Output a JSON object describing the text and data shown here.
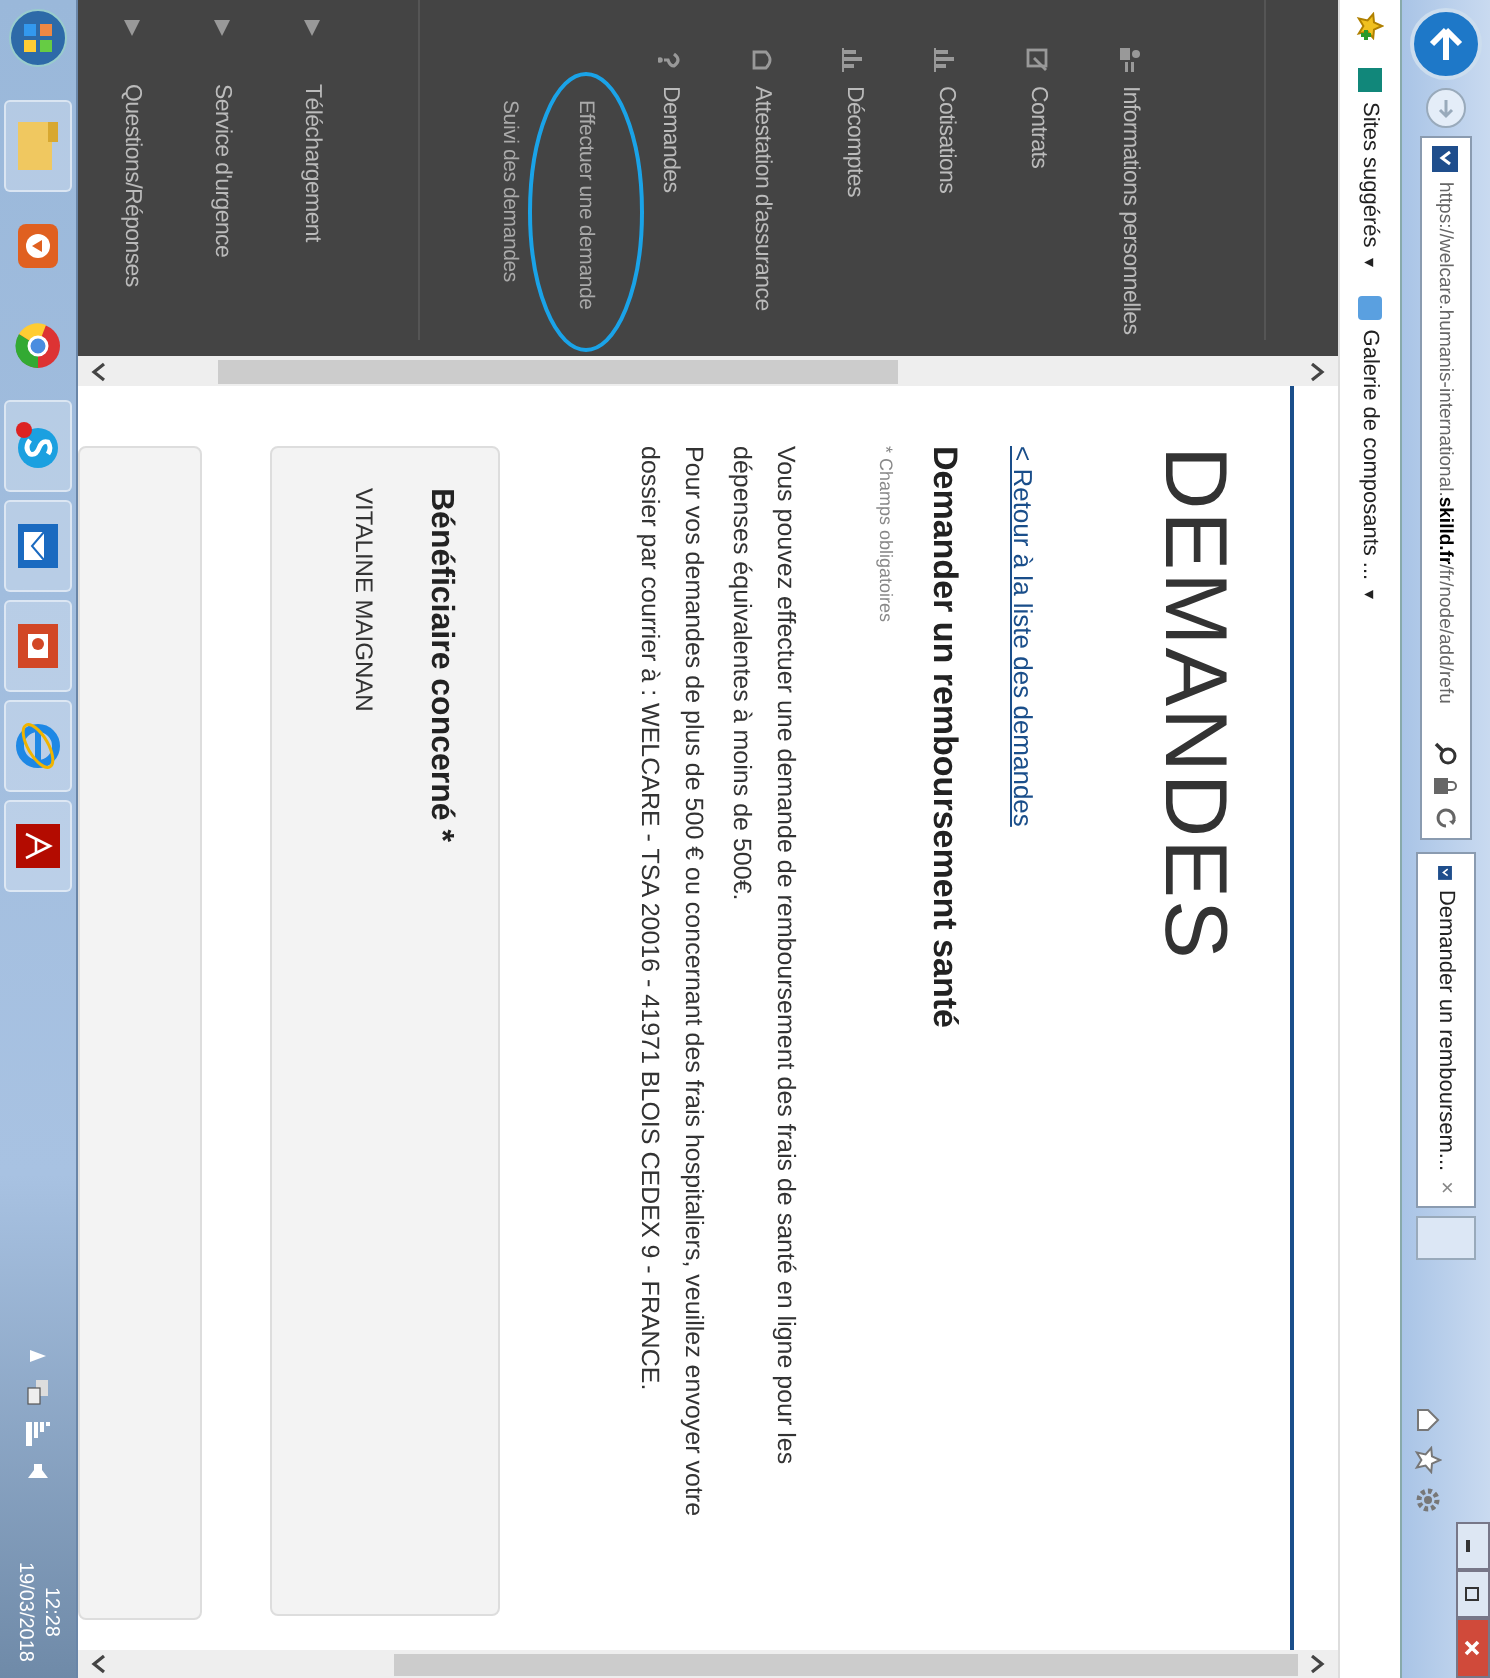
{
  "browser": {
    "address": "https://welcare.humanis-international.**skilld.fr**/fr/node/add/refu",
    "tab": {
      "title": "Demander un remboursem...",
      "close": "×"
    }
  },
  "favorites": [
    {
      "label": "Sites suggérés",
      "caret": "▾"
    },
    {
      "label": "Galerie de composants ...",
      "caret": "▾"
    }
  ],
  "sidebar": {
    "items": [
      {
        "kind": "link",
        "label": "Informations personnelles"
      },
      {
        "kind": "link",
        "label": "Contrats"
      },
      {
        "kind": "link",
        "label": "Cotisations"
      },
      {
        "kind": "link",
        "label": "Décomptes"
      },
      {
        "kind": "link",
        "label": "Attestation d'assurance"
      },
      {
        "kind": "link",
        "label": "Demandes",
        "children": [
          {
            "label": "Effectuer une demande"
          },
          {
            "label": "Suivi des demandes"
          }
        ]
      },
      {
        "kind": "group",
        "label": "Téléchargement"
      },
      {
        "kind": "group",
        "label": "Service d'urgence"
      },
      {
        "kind": "group",
        "label": "Questions/Réponses"
      }
    ]
  },
  "page": {
    "title": "DEMANDES",
    "back_link": "< Retour à la liste des demandes",
    "heading": "Demander un remboursement santé",
    "required_note": "* Champs obligatoires",
    "paragraphs": [
      "Vous pouvez effectuer une demande de remboursement des frais de santé en ligne pour les dépenses équivalentes à moins de 500€.",
      "Pour vos demandes de plus de 500 € ou concernant des frais hospitaliers, veuillez envoyer votre dossier par courrier à : WELCARE - TSA 20016 - 41971 BLOIS CEDEX 9 - FRANCE."
    ],
    "card": {
      "label": "Bénéficiaire concerné *",
      "value": "VITALINE MAIGNAN"
    }
  },
  "taskbar": {
    "time": "12:28",
    "date": "19/03/2018"
  }
}
